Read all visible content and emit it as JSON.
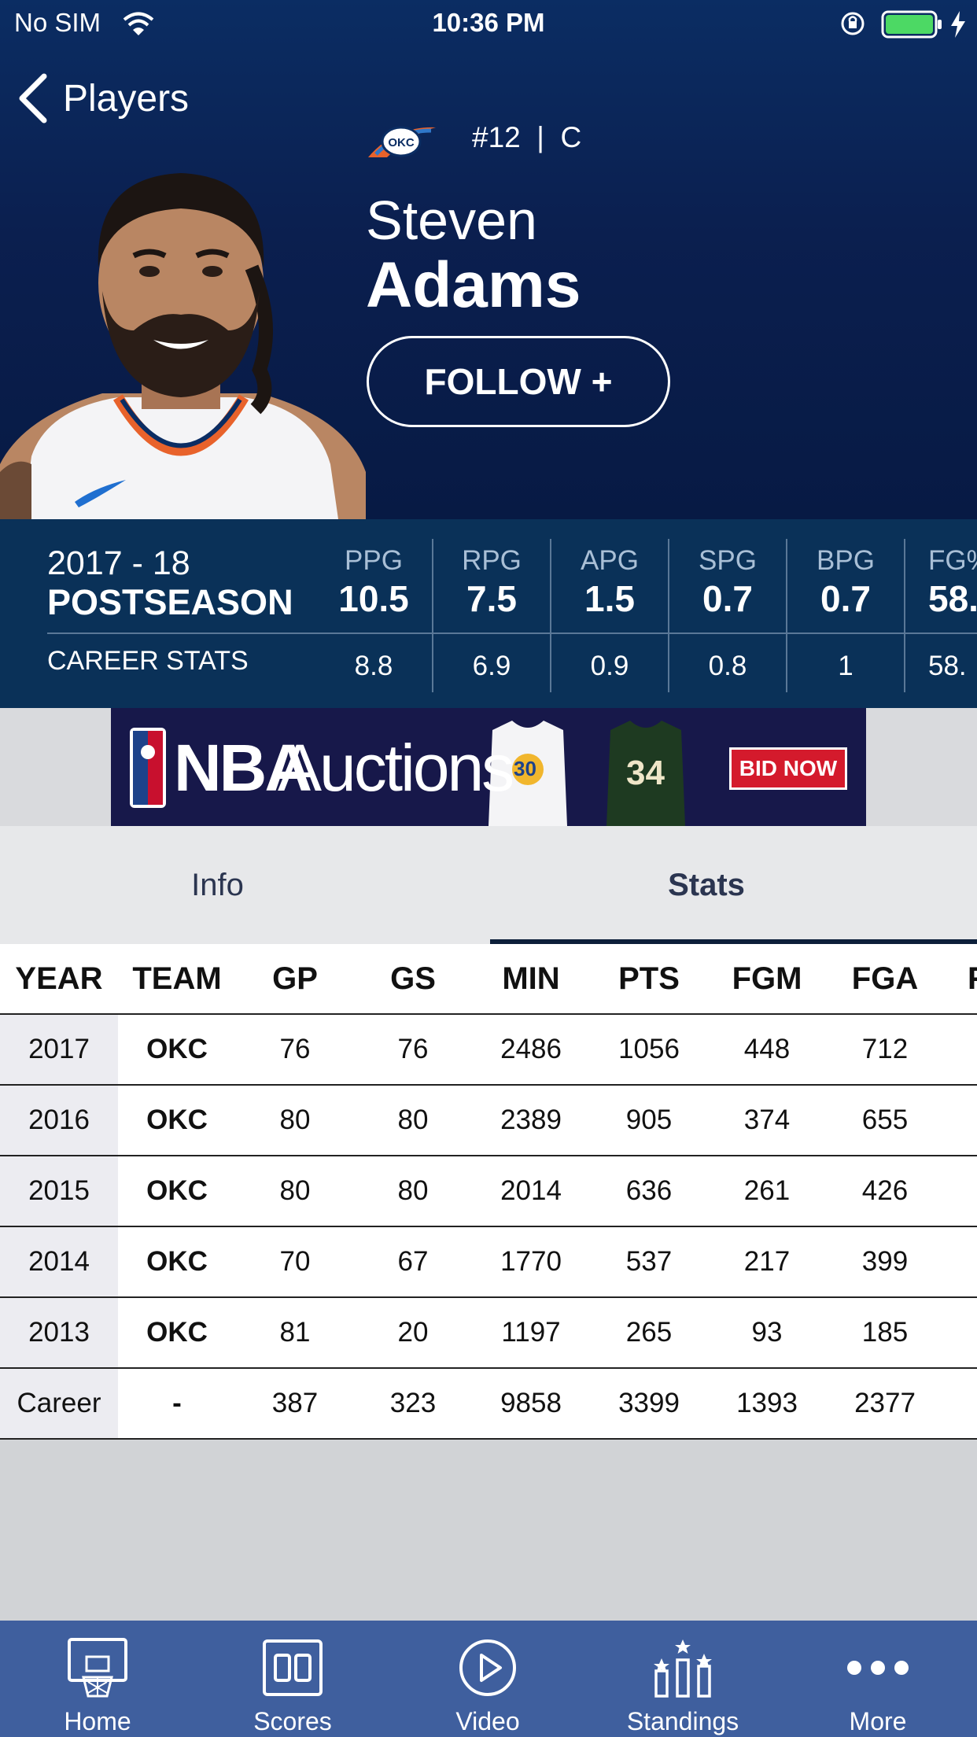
{
  "status_bar": {
    "carrier": "No SIM",
    "time": "10:36 PM"
  },
  "nav": {
    "back_label": "Players"
  },
  "player": {
    "number_position": "#12  |  C",
    "first_name": "Steven",
    "last_name": "Adams",
    "follow_label": "FOLLOW +",
    "team_logo_text": "OKC"
  },
  "season_stats": {
    "season": "2017 - 18",
    "season_type": "POSTSEASON",
    "career_label": "CAREER STATS",
    "columns": [
      {
        "label": "PPG",
        "value": "10.5",
        "career": "8.8"
      },
      {
        "label": "RPG",
        "value": "7.5",
        "career": "6.9"
      },
      {
        "label": "APG",
        "value": "1.5",
        "career": "0.9"
      },
      {
        "label": "SPG",
        "value": "0.7",
        "career": "0.8"
      },
      {
        "label": "BPG",
        "value": "0.7",
        "career": "1"
      },
      {
        "label": "FG%",
        "value": "58.",
        "career": "58."
      }
    ]
  },
  "ad": {
    "brand": "NBA",
    "title": "Auctions",
    "cta": "BID NOW",
    "jersey_left_number": "30",
    "jersey_right_number": "34"
  },
  "tabs": [
    {
      "label": "Info"
    },
    {
      "label": "Stats"
    }
  ],
  "stats_table": {
    "headers": [
      "YEAR",
      "TEAM",
      "GP",
      "GS",
      "MIN",
      "PTS",
      "FGM",
      "FGA",
      "F"
    ],
    "rows": [
      [
        "2017",
        "OKC",
        "76",
        "76",
        "2486",
        "1056",
        "448",
        "712"
      ],
      [
        "2016",
        "OKC",
        "80",
        "80",
        "2389",
        "905",
        "374",
        "655"
      ],
      [
        "2015",
        "OKC",
        "80",
        "80",
        "2014",
        "636",
        "261",
        "426"
      ],
      [
        "2014",
        "OKC",
        "70",
        "67",
        "1770",
        "537",
        "217",
        "399"
      ],
      [
        "2013",
        "OKC",
        "81",
        "20",
        "1197",
        "265",
        "93",
        "185"
      ],
      [
        "Career",
        "-",
        "387",
        "323",
        "9858",
        "3399",
        "1393",
        "2377"
      ]
    ]
  },
  "tab_bar": [
    {
      "label": "Home",
      "icon": "basketball-hoop-icon"
    },
    {
      "label": "Scores",
      "icon": "scoreboard-icon"
    },
    {
      "label": "Video",
      "icon": "play-icon"
    },
    {
      "label": "Standings",
      "icon": "standings-icon"
    },
    {
      "label": "More",
      "icon": "more-dots-icon"
    }
  ],
  "colors": {
    "hero_top": "#0b2d63",
    "band": "#0a3158",
    "tab_bar": "#3f5f9e",
    "battery": "#4cd964"
  }
}
